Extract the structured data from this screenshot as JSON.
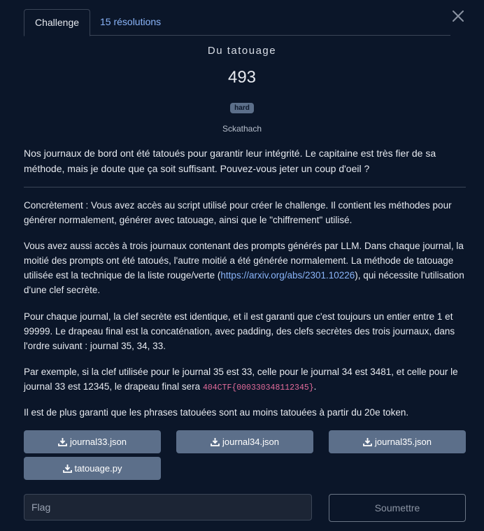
{
  "tabs": {
    "challenge": "Challenge",
    "solves": "15 résolutions"
  },
  "challenge": {
    "name": "Du tatouage",
    "points": "493",
    "difficulty": "hard",
    "author": "Sckathach",
    "intro": "Nos journaux de bord ont été tatoués pour garantir leur intégrité. Le capitaine est très fier de sa méthode, mais je doute que ça soit suffisant. Pouvez-vous jeter un coup d'oeil ?"
  },
  "body": {
    "p1": "Concrètement : Vous avez accès au script utilisé pour créer le challenge. Il contient les méthodes pour générer normalement, générer avec tatouage, ainsi que le \"chiffrement\" utilisé.",
    "p2_before": "Vous avez aussi accès à trois journaux contenant des prompts générés par LLM. Dans chaque journal, la moitié des prompts ont été tatoués, l'autre moitié a été générée normalement. La méthode de tatouage utilisée est la technique de la liste rouge/verte (",
    "p2_link": "https://arxiv.org/abs/2301.10226",
    "p2_after": "), qui nécessite l'utilisation d'une clef secrète.",
    "p3": "Pour chaque journal, la clef secrète est identique, et il est garanti que c'est toujours un entier entre 1 et 99999. Le drapeau final est la concaténation, avec padding, des clefs secrètes des trois journaux, dans l'ordre suivant : journal 35, 34, 33.",
    "p4_before": "Par exemple, si la clef utilisée pour le journal 35 est 33, celle pour le journal 34 est 3481, et celle pour le journal 33 est 12345, le drapeau final sera ",
    "p4_code": "404CTF{000330348112345}",
    "p4_after": ".",
    "p5": "Il est de plus garanti que les phrases tatouées sont au moins tatouées à partir du 20e token."
  },
  "files": [
    "journal33.json",
    "journal34.json",
    "journal35.json",
    "tatouage.py"
  ],
  "form": {
    "flag_placeholder": "Flag",
    "flag_value": "",
    "submit_label": "Soumettre"
  },
  "colors": {
    "background": "#0b1629",
    "button": "#5c6f8a",
    "link": "#8ab4f8",
    "code": "#e26b9a"
  }
}
